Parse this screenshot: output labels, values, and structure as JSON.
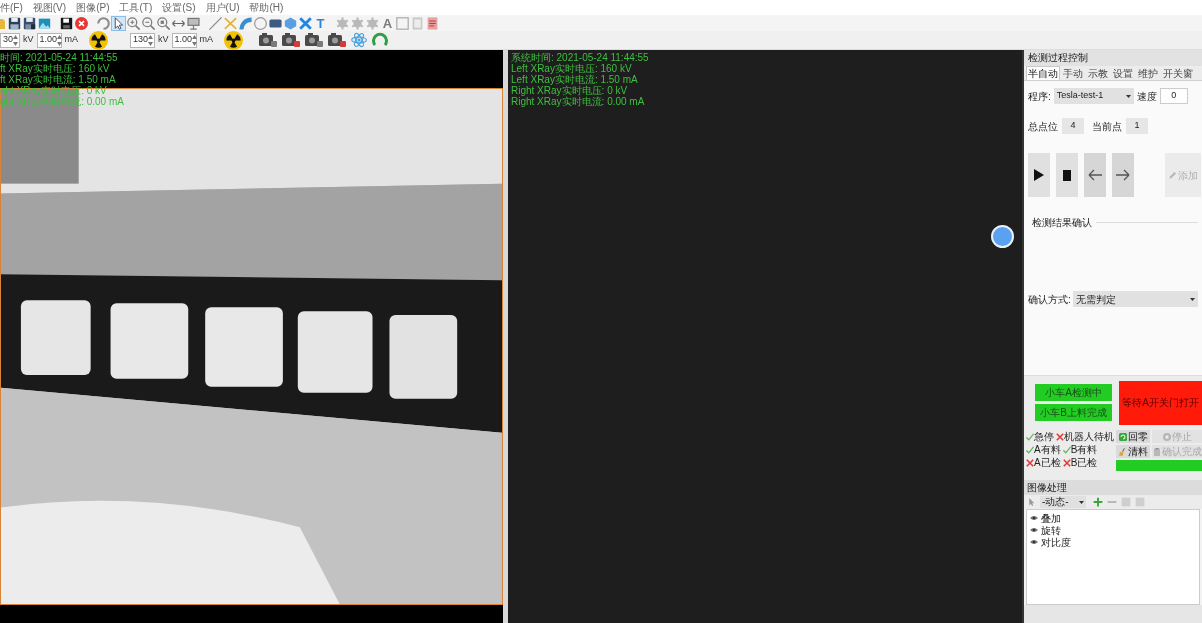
{
  "menu": [
    "件(F)",
    "视图(V)",
    "图像(P)",
    "工具(T)",
    "设置(S)",
    "用户(U)",
    "帮助(H)"
  ],
  "toolbar": {
    "tools": [
      {
        "selected": false
      },
      {
        "selected": false
      },
      {
        "selected": false
      },
      {
        "selected": false
      },
      {
        "selected": false
      },
      {
        "selected": false
      },
      {
        "selected": true
      },
      {
        "selected": false
      },
      {
        "selected": false
      },
      {
        "selected": false
      },
      {
        "selected": false
      },
      {
        "selected": false
      },
      {
        "selected": false
      },
      {
        "selected": false
      },
      {
        "selected": false
      },
      {
        "selected": false
      },
      {
        "selected": false
      },
      {
        "selected": false
      },
      {
        "selected": false
      },
      {
        "selected": false,
        "glyph": "T"
      },
      {
        "selected": false
      },
      {
        "selected": false
      },
      {
        "selected": false
      },
      {
        "selected": false,
        "glyph": "A"
      },
      {
        "selected": false
      },
      {
        "selected": false
      },
      {
        "selected": false
      }
    ]
  },
  "xray_sources": [
    {
      "voltage": "30",
      "voltage_unit": "kV",
      "current": "1.00",
      "current_unit": "mA"
    },
    {
      "voltage": "130",
      "voltage_unit": "kV",
      "current": "1.00",
      "current_unit": "mA"
    }
  ],
  "left_view": {
    "overlay": [
      "时间: 2021-05-24 11:44:55",
      "ft XRay实时电压: 160 kV",
      "ft XRay实时电流: 1.50 mA",
      "ght XRay实时电压: 0 kV",
      "ght XRay实时电流: 0.00 mA"
    ]
  },
  "right_view": {
    "overlay": [
      "系统时间: 2021-05-24 11:44:55",
      "Left XRay实时电压: 160 kV",
      "Left XRay实时电流: 1.50 mA",
      "Right XRay实时电压: 0 kV",
      "Right XRay实时电流: 0.00 mA"
    ]
  },
  "control_panel": {
    "title": "检测过程控制",
    "tabs": [
      {
        "label": "半自动",
        "selected": true
      },
      {
        "label": "手动",
        "selected": false
      },
      {
        "label": "示教",
        "selected": false
      },
      {
        "label": "设置",
        "selected": false
      },
      {
        "label": "维护",
        "selected": false
      },
      {
        "label": "开关窗",
        "selected": false
      }
    ],
    "program": {
      "label": "程序:",
      "value": "Tesla-test-1"
    },
    "speed": {
      "label": "速度",
      "value": "0"
    },
    "total_points": {
      "label": "总点位",
      "value": "4"
    },
    "current_point": {
      "label": "当前点",
      "value": "1"
    },
    "add_button": {
      "label": "添加",
      "disabled": true
    },
    "result_confirmation": {
      "title": "检测结果确认",
      "method_label": "确认方式:",
      "method_value": "无需判定"
    },
    "cart_buttons": [
      "小车A检测中",
      "小车B上料完成"
    ],
    "alert": "等待A开关门打开",
    "status_checks": [
      {
        "label": "急停",
        "ok": true
      },
      {
        "label": "机器人待机",
        "ok": false
      },
      {
        "label": "A有料",
        "ok": true
      },
      {
        "label": "B有料",
        "ok": true
      },
      {
        "label": "A已检",
        "ok": false
      },
      {
        "label": "B已检",
        "ok": false
      }
    ],
    "command_buttons": [
      {
        "label": "回零",
        "disabled": false
      },
      {
        "label": "停止",
        "disabled": true
      },
      {
        "label": "清料",
        "disabled": false
      },
      {
        "label": "确认完成",
        "disabled": true
      }
    ],
    "image_processing": {
      "title": "图像处理",
      "mode": "-动态-",
      "layers": [
        "叠加",
        "旋转",
        "对比度"
      ]
    }
  }
}
